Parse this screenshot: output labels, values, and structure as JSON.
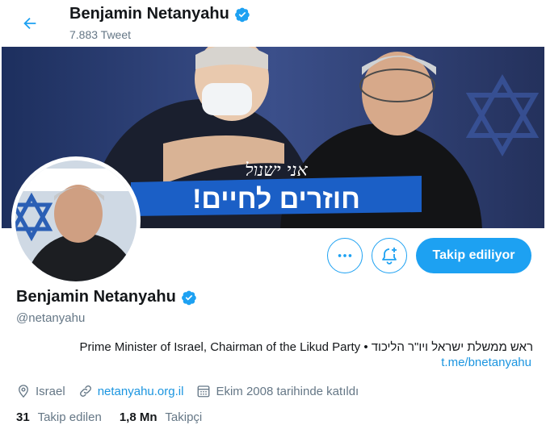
{
  "header": {
    "name": "Benjamin Netanyahu",
    "tweet_count": "7.883 Tweet",
    "icons": {
      "back": "back-arrow-icon",
      "verified": "verified-badge-icon"
    }
  },
  "banner": {
    "headline_text": "חוזרים לחיים!",
    "handwriting_text": "אני ישנול"
  },
  "actions": {
    "more_icon": "more-dots-icon",
    "notify_icon": "bell-plus-icon",
    "follow_label": "Takip ediliyor"
  },
  "profile": {
    "name": "Benjamin Netanyahu",
    "handle": "@netanyahu",
    "bio": "Prime Minister of Israel, Chairman of the Likud Party • ראש ממשלת ישראל ויו\"ר הליכוד",
    "bio_link": "t.me/bnetanyahu"
  },
  "meta": {
    "location": "Israel",
    "website": "netanyahu.org.il",
    "joined": "Ekim 2008 tarihinde katıldı",
    "icons": {
      "location": "location-pin-icon",
      "link": "link-icon",
      "calendar": "calendar-icon"
    }
  },
  "stats": {
    "following_count": "31",
    "following_label": "Takip edilen",
    "followers_count": "1,8 Mn",
    "followers_label": "Takipçi"
  },
  "colors": {
    "accent": "#1da1f2",
    "link": "#1b95e0",
    "muted": "#657786",
    "text": "#14171a"
  }
}
